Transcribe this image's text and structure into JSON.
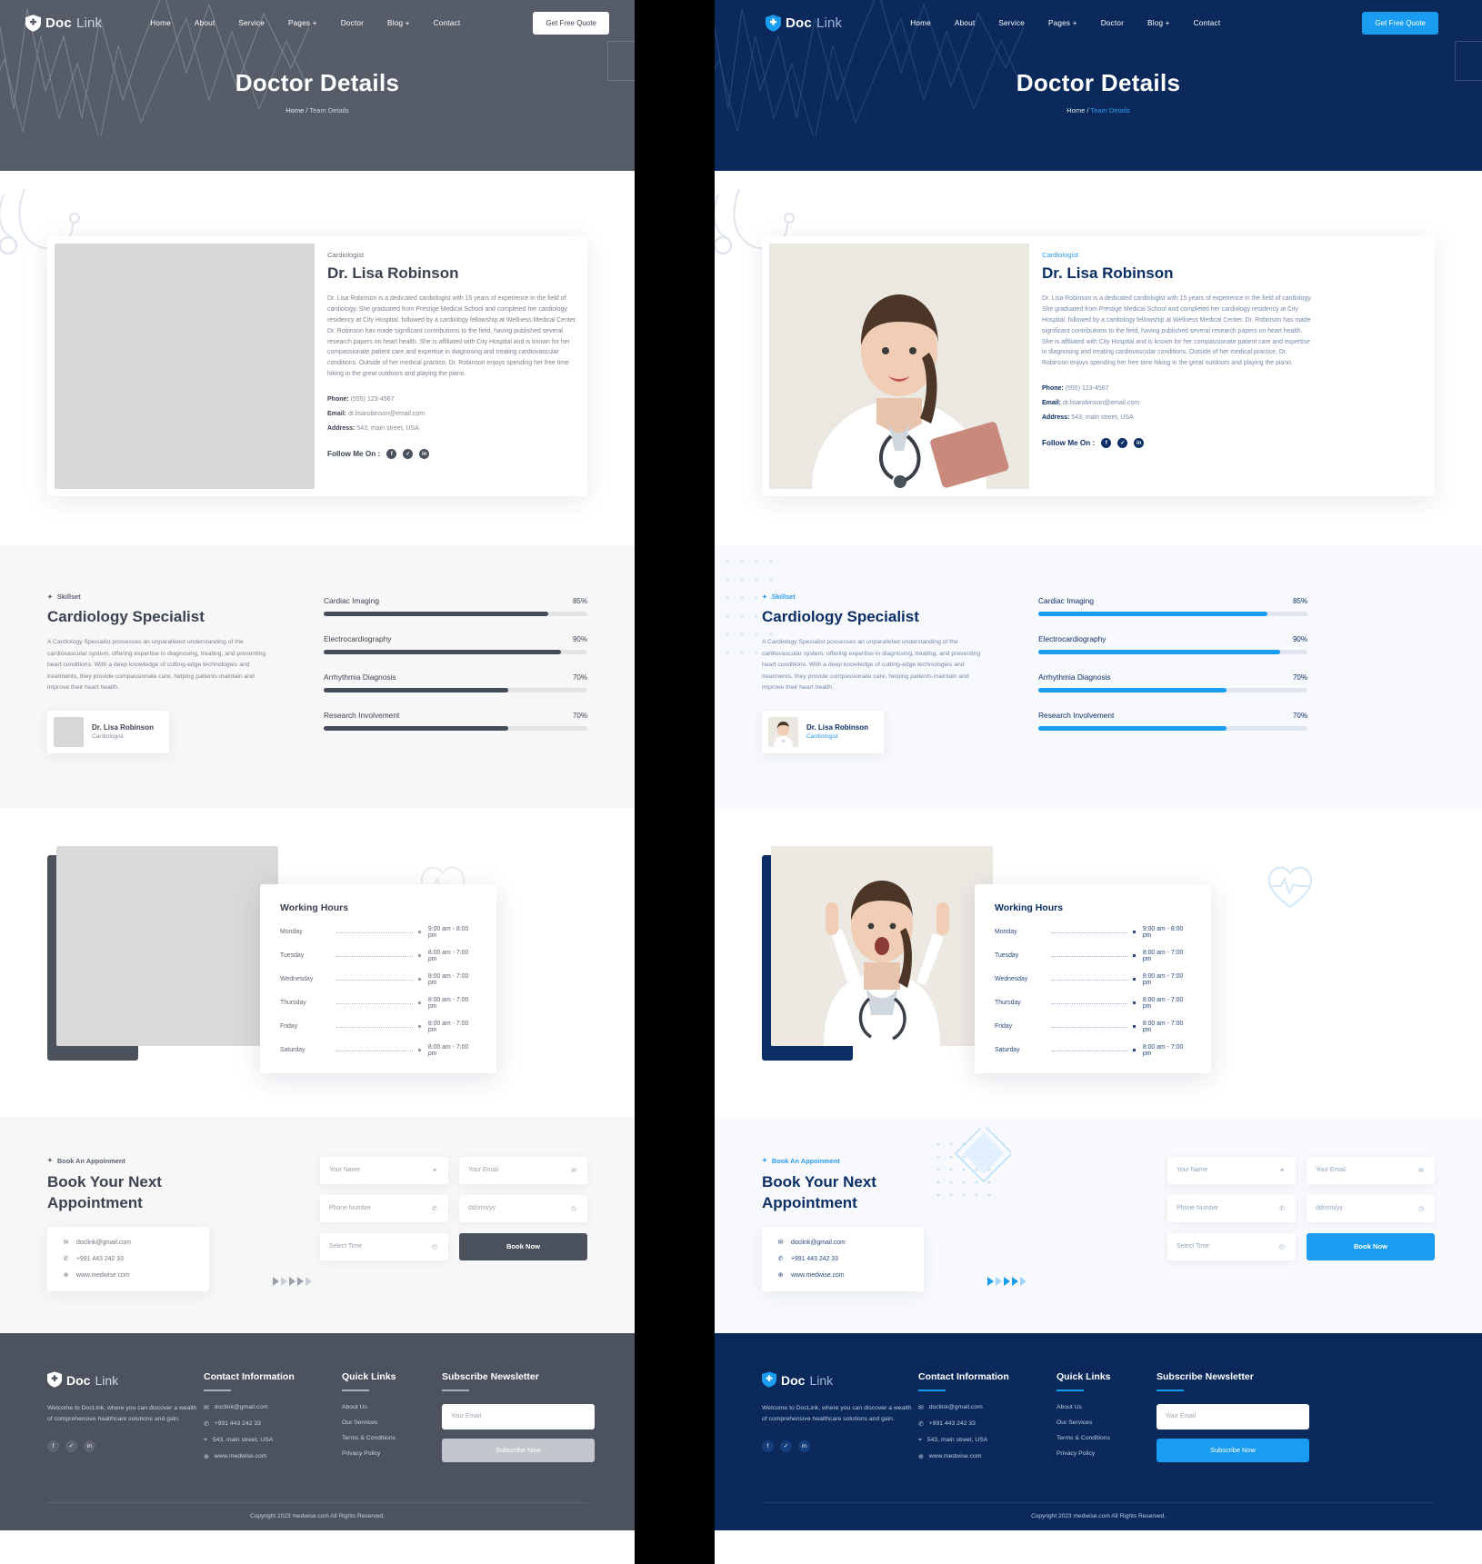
{
  "comparison": {
    "left_variant": "grayscale-wireframe",
    "right_variant": "color-final",
    "divider_color": "#000000"
  },
  "header": {
    "brand": {
      "doc": "Doc",
      "link": "Link",
      "icon": "shield-cross-icon"
    },
    "menu": [
      {
        "label": "Home"
      },
      {
        "label": "About"
      },
      {
        "label": "Service"
      },
      {
        "label": "Pages +"
      },
      {
        "label": "Doctor"
      },
      {
        "label": "Blog +"
      },
      {
        "label": "Contact"
      }
    ],
    "cta": "Get Free Quote"
  },
  "hero": {
    "title": "Doctor Details",
    "breadcrumb_home": "Home",
    "breadcrumb_sep": "/",
    "breadcrumb_current": "Team Details"
  },
  "doctor": {
    "role": "Cardiologist",
    "name": "Dr. Lisa Robinson",
    "bio": "Dr. Lisa Robinson is a dedicated cardiologist with 15 years of experience in the field of cardiology. She graduated from Prestige Medical School and completed her cardiology residency at City Hospital, followed by a cardiology fellowship at Wellness Medical Center. Dr. Robinson has made significant contributions to the field, having published several research papers on heart health. She is affiliated with City Hospital and is known for her compassionate patient care and expertise in diagnosing and treating cardiovascular conditions. Outside of her medical practice, Dr. Robinson enjoys spending her free time hiking in the great outdoors and playing the piano.",
    "phone_label": "Phone:",
    "phone_value": "(555) 123-4567",
    "email_label": "Email:",
    "email_value": "dr.lisarobinson@email.com",
    "address_label": "Address:",
    "address_value": "543, main street, USA",
    "follow_label": "Follow Me On :",
    "social": [
      {
        "name": "facebook-icon",
        "glyph": "f"
      },
      {
        "name": "twitter-icon",
        "glyph": "✓"
      },
      {
        "name": "linkedin-icon",
        "glyph": "in"
      }
    ]
  },
  "skillset": {
    "tag": "Skillset",
    "heading": "Cardiology Specialist",
    "paragraph": "A Cardiology Specialist possesses an unparalleled understanding of the cardiovascular system, offering expertise in diagnosing, treating, and preventing heart conditions. With a deep knowledge of cutting-edge technologies and treatments, they provide compassionate care, helping patients maintain and improve their heart health.",
    "mini_doctor_name": "Dr. Lisa Robinson",
    "mini_doctor_role": "Cardiologist",
    "accent_left": "#454c59",
    "accent_right": "#1a9cf0"
  },
  "chart_data": {
    "type": "bar",
    "title": "Cardiology Specialist skill proficiency",
    "categories": [
      "Cardiac Imaging",
      "Electrocardiography",
      "Arrhythmia Diagnosis",
      "Research Involvement"
    ],
    "values": [
      85,
      90,
      70,
      70
    ],
    "value_labels": [
      "85%",
      "90%",
      "70%",
      "70%"
    ],
    "xlabel": "",
    "ylabel": "",
    "ylim": [
      0,
      100
    ],
    "orientation": "horizontal",
    "grid": false,
    "legend": false
  },
  "working_hours": {
    "title": "Working Hours",
    "rows": [
      {
        "day": "Monday",
        "time": "9:00 am - 8:00 pm"
      },
      {
        "day": "Tuesday",
        "time": "8:00 am - 7:00 pm"
      },
      {
        "day": "Wednesday",
        "time": "8:00 am - 7:00 pm"
      },
      {
        "day": "Thursday",
        "time": "8:00 am - 7:00 pm"
      },
      {
        "day": "Friday",
        "time": "8:00 am - 7:00 pm"
      },
      {
        "day": "Saturday",
        "time": "8:00 am - 7:00 pm"
      }
    ]
  },
  "booking": {
    "tag": "Book An Appoinment",
    "heading_line1": "Book Your Next",
    "heading_line2": "Appointment",
    "contact": [
      {
        "icon": "mail-icon",
        "text": "doclink@gmail.com"
      },
      {
        "icon": "phone-icon",
        "text": "+991 443 242 33"
      },
      {
        "icon": "globe-icon",
        "text": "www.medwise.com"
      }
    ],
    "fields": [
      {
        "placeholder": "Your Name",
        "icon": "user-icon"
      },
      {
        "placeholder": "Your Email",
        "icon": "mail-icon"
      },
      {
        "placeholder": "Phone Number",
        "icon": "phone-icon"
      },
      {
        "placeholder": "dd/mm/yy",
        "icon": "calendar-icon"
      },
      {
        "placeholder": "Select Time",
        "icon": "clock-icon"
      }
    ],
    "submit": "Book Now"
  },
  "footer": {
    "brand": {
      "doc": "Doc",
      "link": "Link"
    },
    "about": "Welcome to DocLink, where you can discover a wealth of comprehensive healthcare solutions and gain.",
    "social": [
      {
        "name": "facebook-icon",
        "glyph": "f"
      },
      {
        "name": "twitter-icon",
        "glyph": "✓"
      },
      {
        "name": "linkedin-icon",
        "glyph": "in"
      }
    ],
    "contact_heading": "Contact Information",
    "contact_items": [
      {
        "icon": "mail-icon",
        "text": "doclink@gmail.com"
      },
      {
        "icon": "phone-icon",
        "text": "+991 443 242 33"
      },
      {
        "icon": "location-icon",
        "text": "543, main street, USA"
      },
      {
        "icon": "globe-icon",
        "text": "www.medwise.com"
      }
    ],
    "quicklinks_heading": "Quick Links",
    "quicklinks": [
      {
        "label": "About Us"
      },
      {
        "label": "Our Services"
      },
      {
        "label": "Terms & Conditions"
      },
      {
        "label": "Privacy Policy"
      }
    ],
    "newsletter_heading": "Subscribe Newsletter",
    "newsletter_placeholder": "Your Email",
    "newsletter_button": "Subscribe Now",
    "copyright": "Copyright 2023 medwise.com All Rights Reserved."
  }
}
